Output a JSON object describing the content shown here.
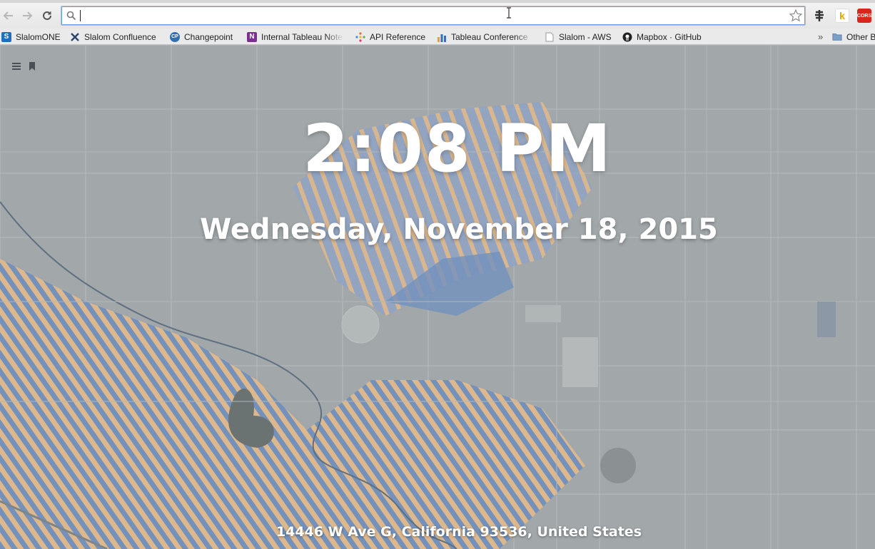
{
  "browser": {
    "omnibox": {
      "value": "",
      "placeholder": ""
    },
    "bookmarks": [
      {
        "label": "SlalomONE",
        "icon": "slalom-s-icon"
      },
      {
        "label": "Slalom Confluence",
        "icon": "confluence-icon"
      },
      {
        "label": "Changepoint",
        "icon": "changepoint-icon"
      },
      {
        "label": "Internal Tableau Note",
        "icon": "onenote-icon"
      },
      {
        "label": "API Reference",
        "icon": "dots-icon"
      },
      {
        "label": "Tableau Conference",
        "icon": "bar-chart-icon"
      },
      {
        "label": "Slalom - AWS",
        "icon": "page-icon"
      },
      {
        "label": "Mapbox · GitHub",
        "icon": "github-icon"
      }
    ],
    "overflow_label": "»",
    "other_bookmarks_label": "Other B",
    "extension_cors_label": "CORS"
  },
  "page": {
    "time": "2:08 PM",
    "date": "Wednesday, November 18, 2015",
    "address": "14446 W Ave G, California 93536, United States"
  },
  "colors": {
    "map_base": "#a2a8aa",
    "map_tan": "#e2b98a",
    "map_blue": "#6f8fbd",
    "omnibox_focus": "#6e9ee3"
  }
}
